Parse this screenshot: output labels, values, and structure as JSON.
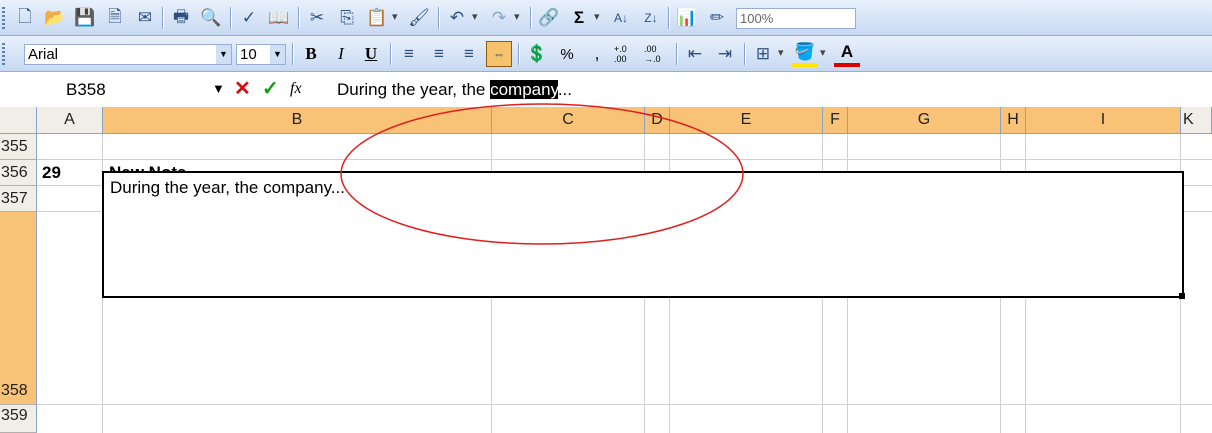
{
  "formatting": {
    "font_name": "Arial",
    "font_size": "10",
    "bold_label": "B",
    "italic_label": "I",
    "underline_label": "U",
    "percent_label": "%",
    "comma_label": ",",
    "increase_decimal_label": "+.0 .00",
    "decrease_decimal_label": ".00 →.0",
    "font_color_label": "A"
  },
  "standard": {
    "autosum_label": "Σ",
    "zoom_value": "100%"
  },
  "formula_bar": {
    "name_box": "B358",
    "fx_label": "fx",
    "content_prefix": "During the year, the ",
    "content_selected": "company",
    "content_suffix": "..."
  },
  "columns": [
    "A",
    "B",
    "C",
    "D",
    "E",
    "F",
    "G",
    "H",
    "I",
    "K"
  ],
  "rows": [
    {
      "num": "355",
      "a": "",
      "b": ""
    },
    {
      "num": "356",
      "a": "29",
      "b": "New Note"
    },
    {
      "num": "357",
      "a": "",
      "b": ""
    },
    {
      "num": "358",
      "a": "",
      "b": ""
    },
    {
      "num": "359",
      "a": "",
      "b": ""
    }
  ],
  "editing_cell_text": "During the year, the company...",
  "colors": {
    "selected_header": "#f9c377",
    "annotation_circle": "#e02020",
    "toolbar_top": "#e9f1fc",
    "toolbar_bottom": "#c7d9f2"
  }
}
